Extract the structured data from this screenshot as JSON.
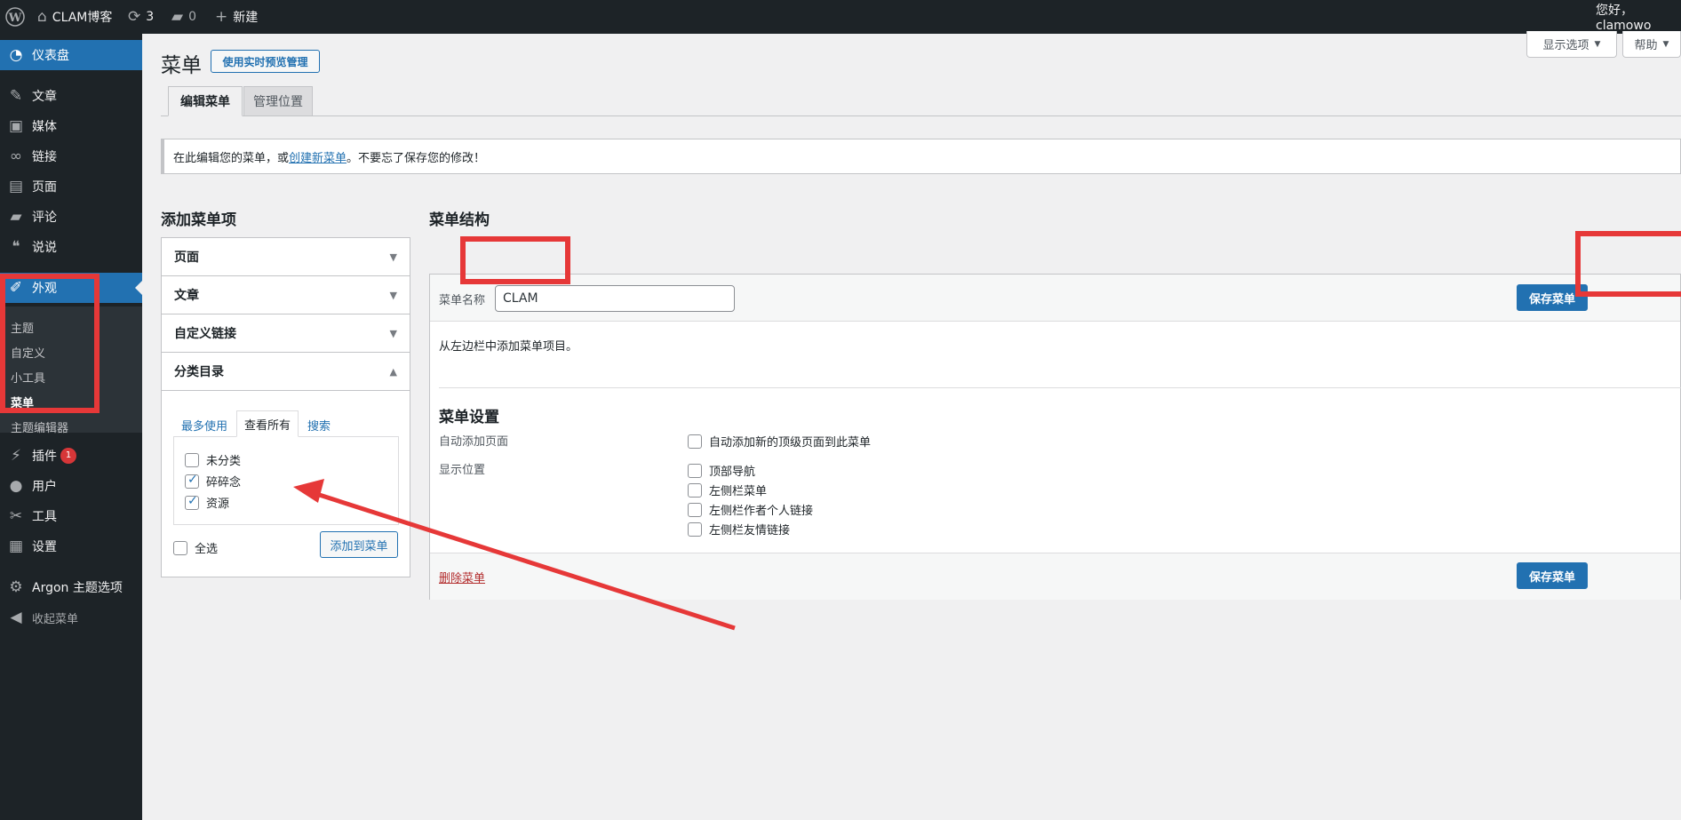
{
  "adminbar": {
    "site_name": "CLAM博客",
    "updates_count": "3",
    "comments_count": "0",
    "new_label": "新建",
    "greeting": "您好，clamowo"
  },
  "sidebar": {
    "dashboard": "仪表盘",
    "posts": "文章",
    "media": "媒体",
    "links": "链接",
    "pages": "页面",
    "comments": "评论",
    "shuoshuo": "说说",
    "appearance": "外观",
    "appearance_sub": [
      "主题",
      "自定义",
      "小工具",
      "菜单",
      "主题编辑器"
    ],
    "plugins": "插件",
    "plugins_badge": "1",
    "users": "用户",
    "tools": "工具",
    "settings": "设置",
    "argon": "Argon 主题选项",
    "collapse": "收起菜单"
  },
  "screen_meta": {
    "screen_options": "显示选项",
    "help": "帮助"
  },
  "page": {
    "title": "菜单",
    "live_preview_button": "使用实时预览管理",
    "tabs": [
      "编辑菜单",
      "管理位置"
    ],
    "notice_before": "在此编辑您的菜单，或",
    "notice_link": "创建新菜单",
    "notice_after": "。不要忘了保存您的修改！"
  },
  "add_items": {
    "heading": "添加菜单项",
    "sections": [
      "页面",
      "文章",
      "自定义链接",
      "分类目录"
    ],
    "category_tabs": [
      "最多使用",
      "查看所有",
      "搜索"
    ],
    "categories": [
      {
        "label": "未分类",
        "checked": false
      },
      {
        "label": "碎碎念",
        "checked": true
      },
      {
        "label": "资源",
        "checked": true
      }
    ],
    "select_all": "全选",
    "add_button": "添加到菜单"
  },
  "structure": {
    "heading": "菜单结构",
    "name_label": "菜单名称",
    "name_value": "CLAM",
    "save_button": "保存菜单",
    "hint": "从左边栏中添加菜单项目。",
    "settings_heading": "菜单设置",
    "auto_add_label": "自动添加页面",
    "auto_add_option": "自动添加新的顶级页面到此菜单",
    "location_label": "显示位置",
    "locations": [
      "顶部导航",
      "左侧栏菜单",
      "左侧栏作者个人链接",
      "左侧栏友情链接"
    ],
    "delete_link": "删除菜单"
  },
  "colors": {
    "accent": "#2271b1",
    "highlight_red": "#e63838",
    "admin_dark": "#1d2327"
  }
}
